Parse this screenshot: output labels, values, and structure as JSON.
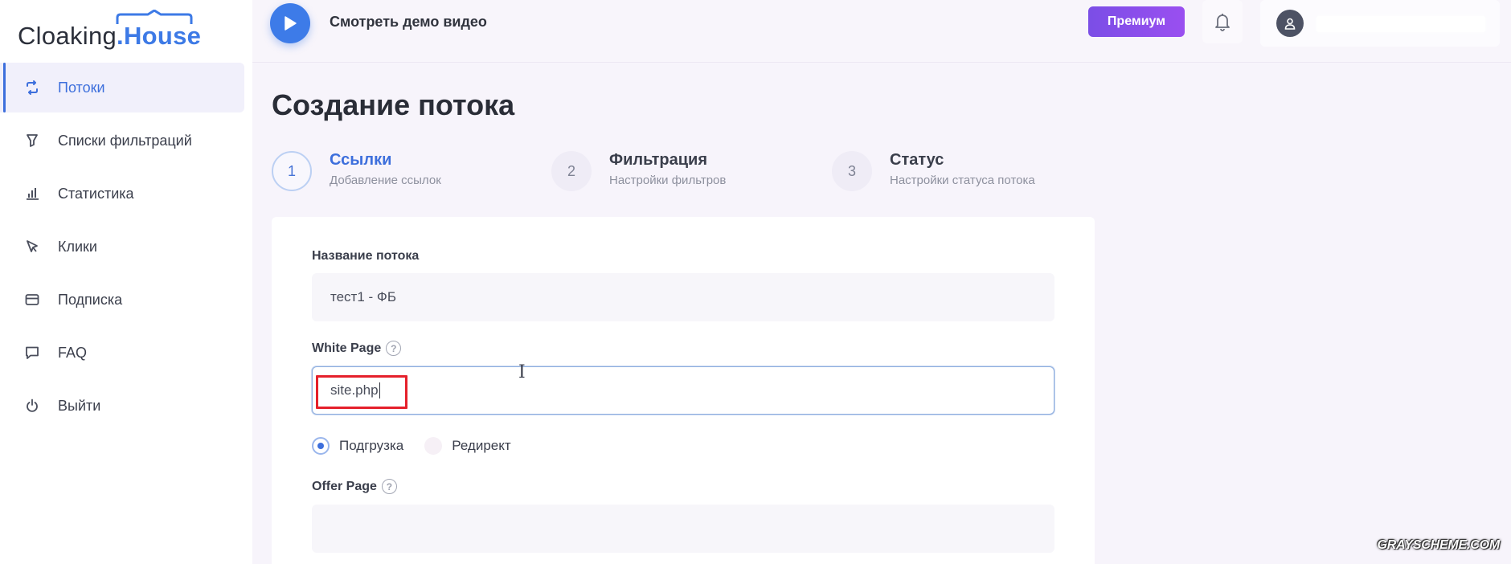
{
  "logo": {
    "part1": "Cloaking",
    "part2": ".House"
  },
  "sidebar": {
    "items": [
      {
        "label": "Потоки",
        "icon": "refresh-icon",
        "active": true
      },
      {
        "label": "Списки фильтраций",
        "icon": "filter-icon",
        "active": false
      },
      {
        "label": "Статистика",
        "icon": "bar-chart-icon",
        "active": false
      },
      {
        "label": "Клики",
        "icon": "cursor-icon",
        "active": false
      },
      {
        "label": "Подписка",
        "icon": "card-icon",
        "active": false
      },
      {
        "label": "FAQ",
        "icon": "chat-icon",
        "active": false
      },
      {
        "label": "Выйти",
        "icon": "power-icon",
        "active": false
      }
    ]
  },
  "header": {
    "demo_label": "Смотреть демо видео",
    "premium_label": "Премиум"
  },
  "page": {
    "title": "Создание потока"
  },
  "steps": [
    {
      "number": "1",
      "title": "Ссылки",
      "subtitle": "Добавление ссылок",
      "state": "active"
    },
    {
      "number": "2",
      "title": "Фильтрация",
      "subtitle": "Настройки фильтров",
      "state": "inactive"
    },
    {
      "number": "3",
      "title": "Статус",
      "subtitle": "Настройки статуса потока",
      "state": "inactive"
    }
  ],
  "form": {
    "flow_name_label": "Название потока",
    "flow_name_value": "тест1 - ФБ",
    "white_page_label": "White Page",
    "white_page_value": "site.php",
    "help_glyph": "?",
    "mode_options": [
      {
        "label": "Подгрузка",
        "selected": true
      },
      {
        "label": "Редирект",
        "selected": false
      }
    ],
    "offer_page_label": "Offer Page",
    "offer_page_value": ""
  },
  "colors": {
    "accent": "#3d6fdc",
    "premium": "#8a4fec",
    "highlight": "#e5202b"
  },
  "watermark": "GRAYSCHEME.COM"
}
